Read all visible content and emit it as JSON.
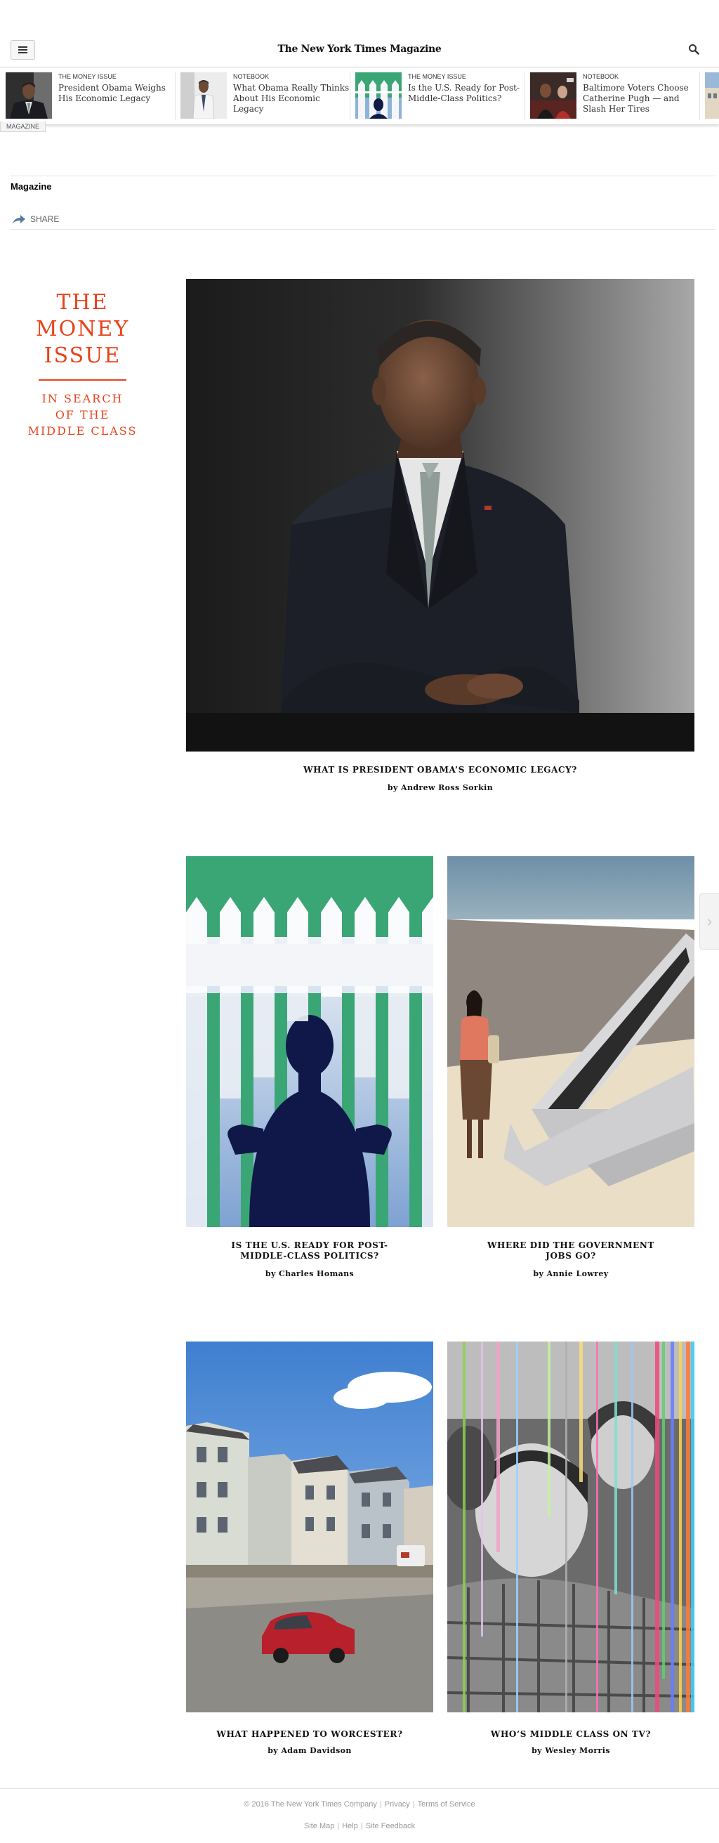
{
  "header": {
    "logo": "The New York Times Magazine",
    "menu_icon": "hamburger-icon",
    "search_icon": "search-icon"
  },
  "ribbon": {
    "items": [
      {
        "kicker": "THE MONEY ISSUE",
        "title": "President Obama Weighs His Economic Legacy"
      },
      {
        "kicker": "NOTEBOOK",
        "title": "What Obama Really Thinks About His Economic Legacy"
      },
      {
        "kicker": "THE MONEY ISSUE",
        "title": "Is the U.S. Ready for Post-Middle-Class Politics?"
      },
      {
        "kicker": "NOTEBOOK",
        "title": "Baltimore Voters Choose Catherine Pugh — and Slash Her Tires"
      }
    ],
    "section_tab": "MAGAZINE"
  },
  "section": {
    "name": "Magazine",
    "share_label": "SHARE",
    "share_icon": "share-arrow-icon"
  },
  "issue": {
    "title_lines": [
      "THE",
      "MONEY",
      "ISSUE"
    ],
    "subtitle_lines": [
      "IN SEARCH",
      "OF THE",
      "MIDDLE CLASS"
    ],
    "accent_color": "#e8421c"
  },
  "articles": {
    "lead": {
      "headline": "WHAT IS PRESIDENT OBAMA’S ECONOMIC LEGACY?",
      "byline": "by Andrew Ross Sorkin"
    },
    "politics": {
      "headline_lines": [
        "IS THE U.S. READY FOR POST-",
        "MIDDLE-CLASS POLITICS?"
      ],
      "byline": "by Charles Homans"
    },
    "jobs": {
      "headline_lines": [
        "WHERE DID THE GOVERNMENT",
        "JOBS GO?"
      ],
      "byline": "by Annie Lowrey"
    },
    "worcester": {
      "headline": "WHAT HAPPENED TO WORCESTER?",
      "byline": "by Adam Davidson"
    },
    "tv": {
      "headline": "WHO’S MIDDLE CLASS ON TV?",
      "byline": "by Wesley Morris"
    }
  },
  "footer": {
    "copyright": "© 2016 The New York Times Company",
    "privacy": "Privacy",
    "terms": "Terms of Service",
    "site_map": "Site Map",
    "help": "Help",
    "feedback": "Site Feedback"
  }
}
